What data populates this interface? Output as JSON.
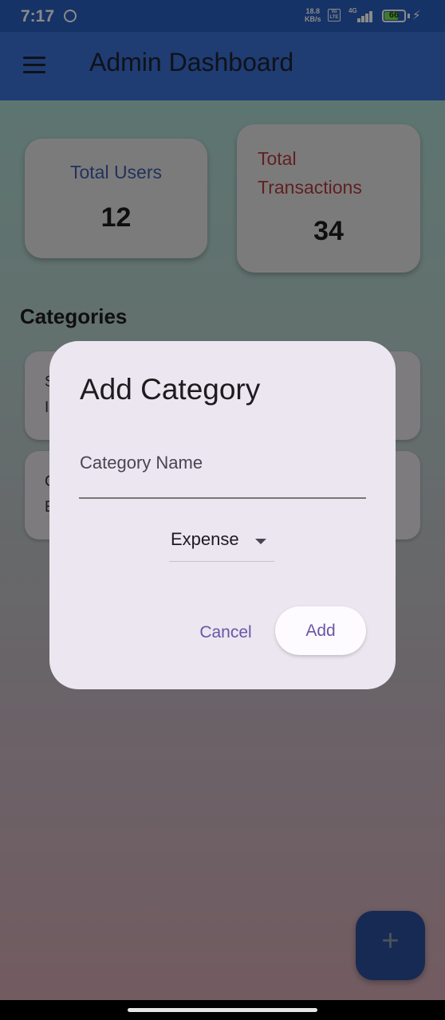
{
  "status_bar": {
    "time": "7:17",
    "speed_value": "18.8",
    "speed_unit": "KB/s",
    "volte": "Vo LTE",
    "network": "4G",
    "battery": "66"
  },
  "app_bar": {
    "title": "Admin Dashboard",
    "menu_icon": "hamburger-menu-icon"
  },
  "stats": {
    "users": {
      "label": "Total Users",
      "value": "12",
      "label_color": "#3b5fa8"
    },
    "transactions": {
      "label": "Total Transactions",
      "value": "34",
      "label_color": "#b23c3c"
    }
  },
  "categories": {
    "title": "Categories",
    "items": [
      {
        "name": "S",
        "type": "I"
      },
      {
        "name": "C",
        "type": "E"
      }
    ]
  },
  "dialog": {
    "title": "Add Category",
    "name_field": {
      "label": "Category Name",
      "value": ""
    },
    "type_dropdown": {
      "selected": "Expense"
    },
    "cancel_label": "Cancel",
    "add_label": "Add"
  },
  "fab": {
    "icon": "plus-icon",
    "label": "+"
  }
}
